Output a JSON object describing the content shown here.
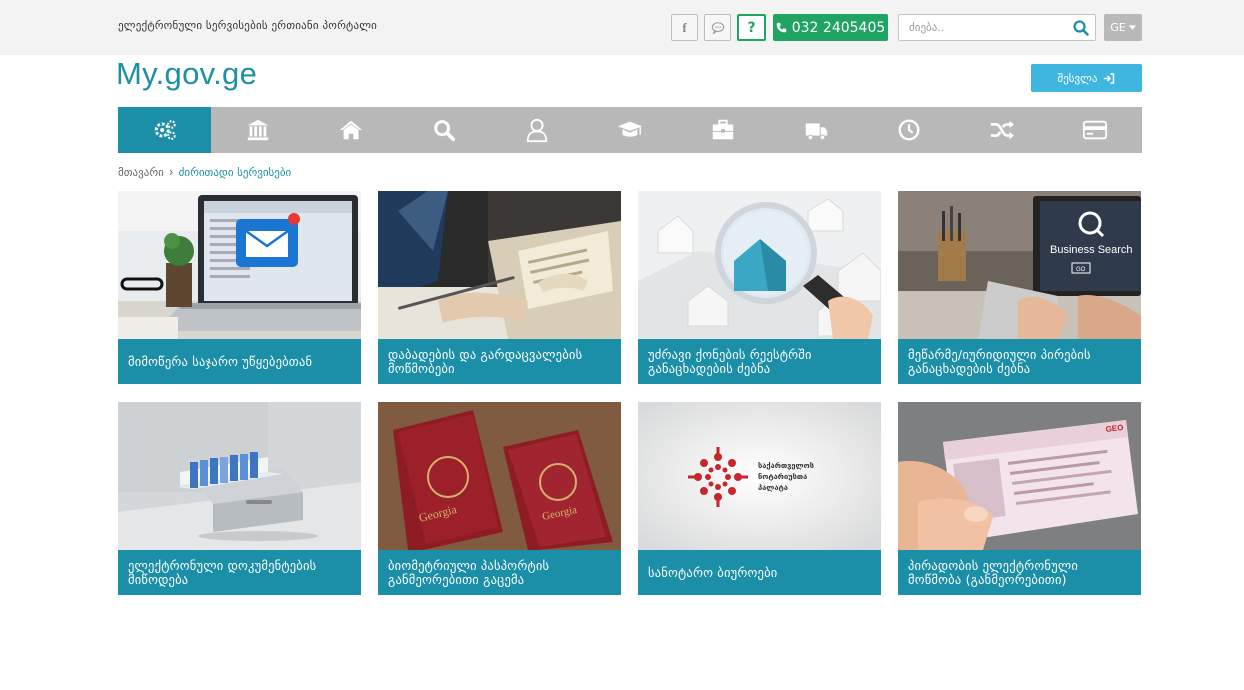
{
  "header": {
    "portal_title": "ელექტრონული სერვისების ერთიანი პორტალი",
    "facebook_label": "f",
    "help_label": "?",
    "phone": "032 2405405",
    "search_placeholder": "ძიება..",
    "language": "GE"
  },
  "brand": {
    "logo": "My.gov.ge",
    "login_label": "შესვლა"
  },
  "nav": {
    "items": [
      {
        "icon": "gears-icon",
        "active": true
      },
      {
        "icon": "bank-icon"
      },
      {
        "icon": "home-icon"
      },
      {
        "icon": "search-icon"
      },
      {
        "icon": "user-icon"
      },
      {
        "icon": "graduation-cap-icon"
      },
      {
        "icon": "briefcase-icon"
      },
      {
        "icon": "truck-icon"
      },
      {
        "icon": "clock-icon"
      },
      {
        "icon": "shuffle-icon"
      },
      {
        "icon": "credit-card-icon"
      }
    ]
  },
  "breadcrumb": {
    "home": "მთავარი",
    "current": "ძირითადი სერვისები"
  },
  "services": [
    {
      "label": "მიმოწერა საჯარო უწყებებთან"
    },
    {
      "label": "დაბადების და გარდაცვალების მოწმობები"
    },
    {
      "label": "უძრავი ქონების რეესტრში განაცხადების ძებნა"
    },
    {
      "label": "მეწარმე/იურიდიული პირების განაცხადების ძებნა"
    },
    {
      "label": "ელექტრონული დოკუმენტების მიწოდება"
    },
    {
      "label": "ბიომეტრიული პასპორტის განმეორებითი გაცემა"
    },
    {
      "label": "სანოტარო ბიუროები"
    },
    {
      "label": "პირადობის ელექტრონული მოწმობა (განმეორებითი)"
    }
  ],
  "image_text": {
    "business_search": "Business Search",
    "go": "GO",
    "georgia": "Georgia",
    "notary_line1": "საქართველოს",
    "notary_line2": "ნოტარიუსთა",
    "notary_line3": "პალატა",
    "geo": "GEO"
  },
  "colors": {
    "accent": "#1b8fa8",
    "green": "#1fa463",
    "login": "#3fb6e0",
    "nav_bg": "#b8b8b8"
  }
}
